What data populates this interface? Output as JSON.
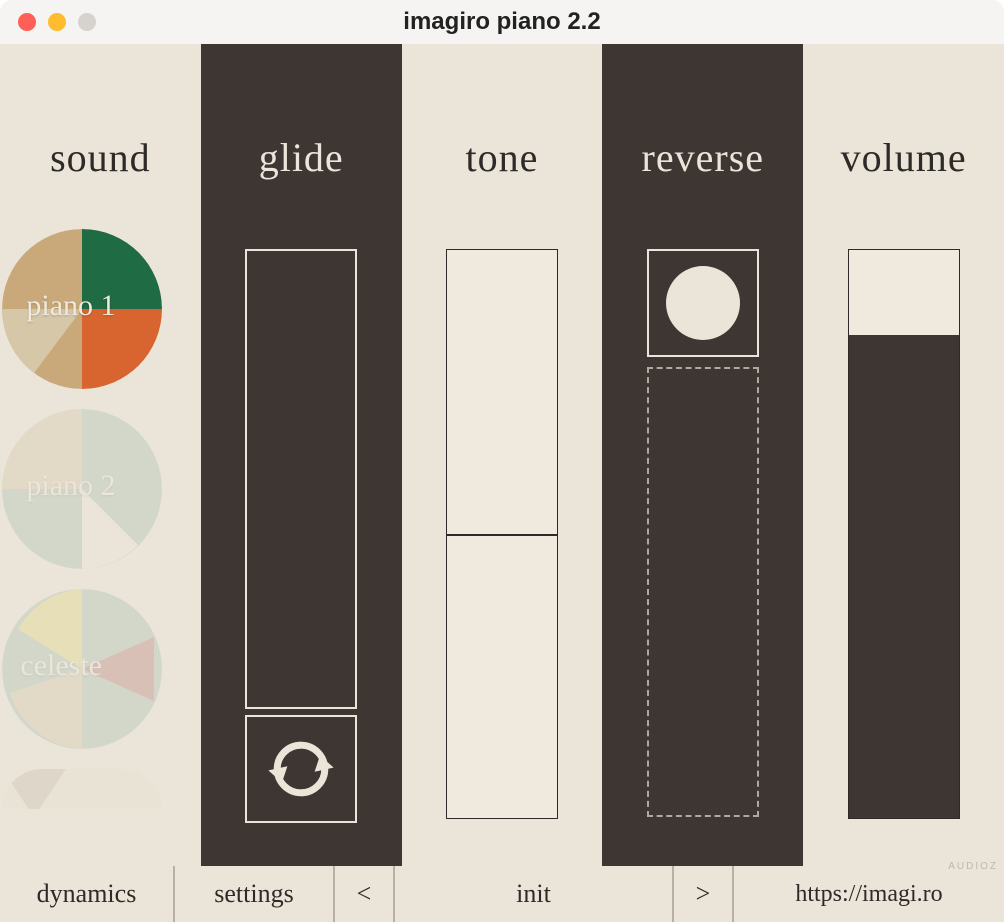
{
  "window": {
    "title": "imagiro piano 2.2"
  },
  "columns": {
    "sound": {
      "label": "sound"
    },
    "glide": {
      "label": "glide"
    },
    "tone": {
      "label": "tone"
    },
    "reverse": {
      "label": "reverse"
    },
    "volume": {
      "label": "volume"
    }
  },
  "sounds": {
    "items": [
      {
        "label": "piano 1",
        "active": true
      },
      {
        "label": "piano 2",
        "active": false
      },
      {
        "label": "celeste",
        "active": false
      }
    ]
  },
  "tone": {
    "value": 0.5
  },
  "volume": {
    "value": 0.85
  },
  "bottombar": {
    "dynamics": "dynamics",
    "settings": "settings",
    "prev": "<",
    "preset": "init",
    "next": ">",
    "url": "https://imagi.ro"
  },
  "watermark": "AUDIOZ",
  "colors": {
    "dark": "#3d3633",
    "light": "#eae4d9",
    "green": "#1e6b44",
    "orange": "#d8652f",
    "tan": "#c9a97a",
    "sage": "#a9c0ad",
    "yellow": "#e4d87a",
    "rose": "#b77f79"
  }
}
